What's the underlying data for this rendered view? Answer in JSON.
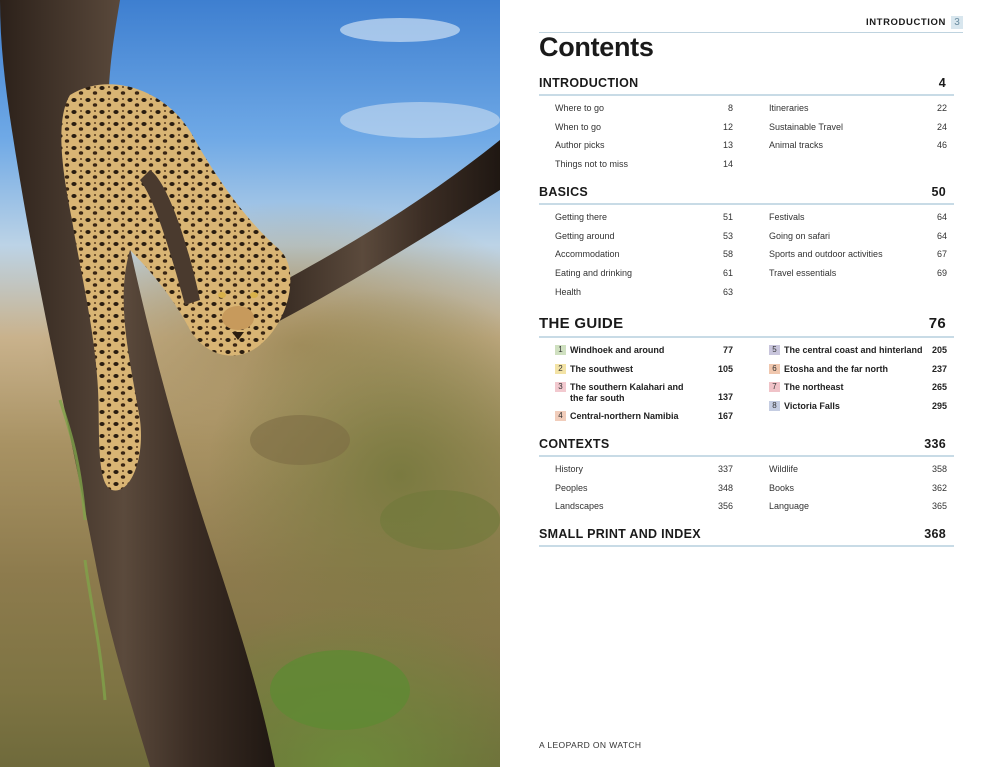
{
  "running_head": {
    "section": "INTRODUCTION",
    "page": "3"
  },
  "title": "Contents",
  "caption": "A LEOPARD ON WATCH",
  "sections": {
    "introduction": {
      "title": "INTRODUCTION",
      "page": "4",
      "left": [
        {
          "label": "Where to go",
          "page": "8"
        },
        {
          "label": "When to go",
          "page": "12"
        },
        {
          "label": "Author picks",
          "page": "13"
        },
        {
          "label": "Things not to miss",
          "page": "14"
        }
      ],
      "right": [
        {
          "label": "Itineraries",
          "page": "22"
        },
        {
          "label": "Sustainable Travel",
          "page": "24"
        },
        {
          "label": "Animal tracks",
          "page": "46"
        }
      ]
    },
    "basics": {
      "title": "BASICS",
      "page": "50",
      "left": [
        {
          "label": "Getting there",
          "page": "51"
        },
        {
          "label": "Getting around",
          "page": "53"
        },
        {
          "label": "Accommodation",
          "page": "58"
        },
        {
          "label": "Eating and drinking",
          "page": "61"
        },
        {
          "label": "Health",
          "page": "63"
        }
      ],
      "right": [
        {
          "label": "Festivals",
          "page": "64"
        },
        {
          "label": "Going on safari",
          "page": "64"
        },
        {
          "label": "Sports and outdoor activities",
          "page": "67"
        },
        {
          "label": "Travel essentials",
          "page": "69"
        }
      ]
    },
    "guide": {
      "title": "THE GUIDE",
      "page": "76",
      "left": [
        {
          "num": "1",
          "label": "Windhoek and around",
          "page": "77",
          "color": "#cfe0c0"
        },
        {
          "num": "2",
          "label": "The southwest",
          "page": "105",
          "color": "#f3e3a6"
        },
        {
          "num": "3",
          "label": "The southern Kalahari and the far south",
          "page": "137",
          "color": "#f2c9cf"
        },
        {
          "num": "4",
          "label": "Central-northern Namibia",
          "page": "167",
          "color": "#f1cdbb"
        }
      ],
      "right": [
        {
          "num": "5",
          "label": "The central coast and hinterland",
          "page": "205",
          "color": "#c8c5dc"
        },
        {
          "num": "6",
          "label": "Etosha and the far north",
          "page": "237",
          "color": "#f0c7ae"
        },
        {
          "num": "7",
          "label": "The northeast",
          "page": "265",
          "color": "#f0c3c8"
        },
        {
          "num": "8",
          "label": "Victoria Falls",
          "page": "295",
          "color": "#c5cde2"
        }
      ]
    },
    "contexts": {
      "title": "CONTEXTS",
      "page": "336",
      "left": [
        {
          "label": "History",
          "page": "337"
        },
        {
          "label": "Peoples",
          "page": "348"
        },
        {
          "label": "Landscapes",
          "page": "356"
        }
      ],
      "right": [
        {
          "label": "Wildlife",
          "page": "358"
        },
        {
          "label": "Books",
          "page": "362"
        },
        {
          "label": "Language",
          "page": "365"
        }
      ]
    },
    "small_print": {
      "title": "SMALL PRINT AND INDEX",
      "page": "368"
    }
  }
}
